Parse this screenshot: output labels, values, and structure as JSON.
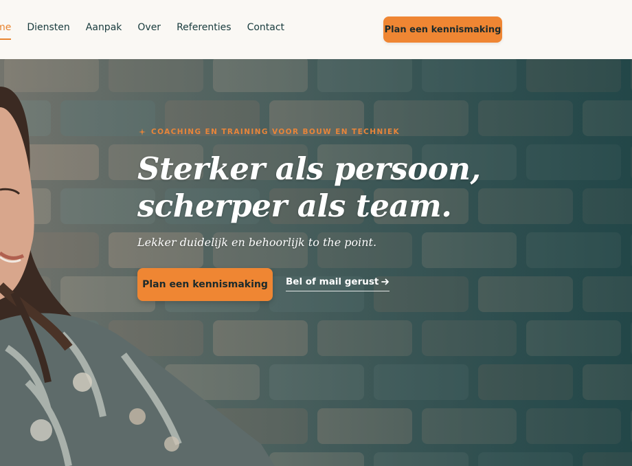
{
  "colors": {
    "accent": "#ef8633",
    "nav_text": "#173a3c",
    "header_bg": "#faf8f4",
    "hero_overlay": "#1e3e40"
  },
  "nav": {
    "items": [
      {
        "label": "Home",
        "active": true
      },
      {
        "label": "Diensten",
        "active": false
      },
      {
        "label": "Aanpak",
        "active": false
      },
      {
        "label": "Over",
        "active": false
      },
      {
        "label": "Referenties",
        "active": false
      },
      {
        "label": "Contact",
        "active": false
      }
    ],
    "cta_label": "Plan een kennismaking"
  },
  "hero": {
    "eyebrow": "COACHING EN TRAINING VOOR BOUW EN TECHNIEK",
    "eyebrow_icon": "sparkle-icon",
    "headline_line1": "Sterker als persoon,",
    "headline_line2": "scherper als team.",
    "subline": "Lekker duidelijk en behoorlijk to the point.",
    "primary_cta": "Plan een kennismaking",
    "secondary_link": "Bel of mail gerust",
    "secondary_icon": "arrow-right-icon"
  }
}
